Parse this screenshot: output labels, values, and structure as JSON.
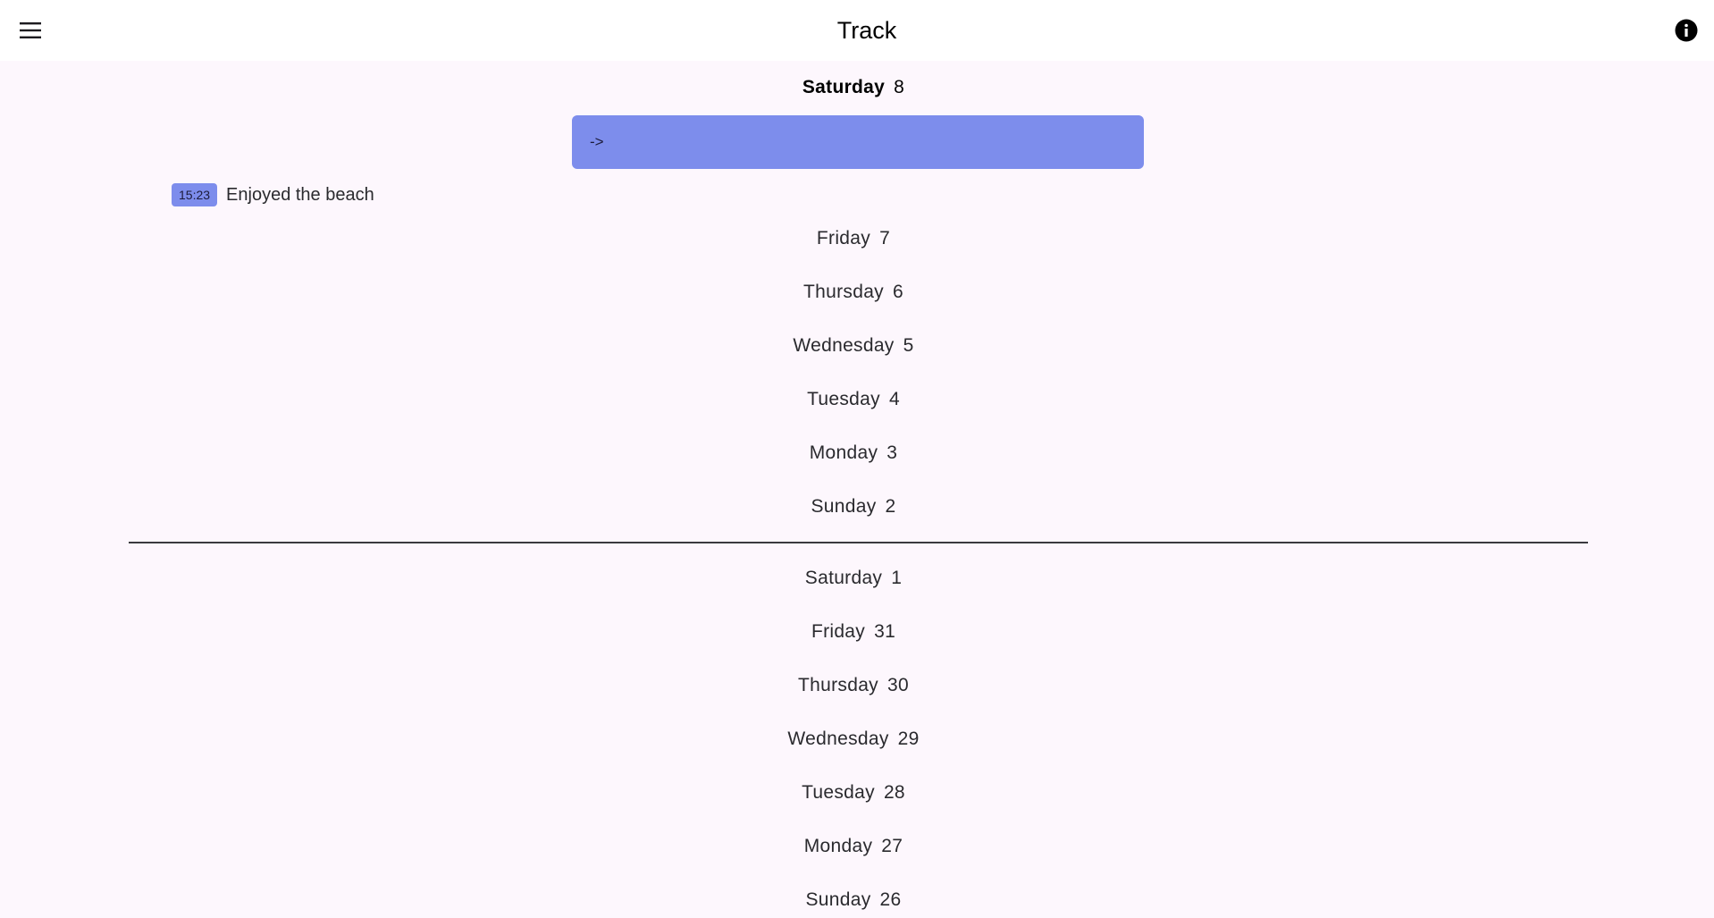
{
  "app_bar": {
    "title": "Track",
    "menu_icon": "hamburger-menu-icon",
    "info_icon": "info-icon"
  },
  "today": {
    "day_name": "Saturday",
    "day_number": "8"
  },
  "entry": {
    "prefix": "->"
  },
  "log": {
    "time": "15:23",
    "text": "Enjoyed the beach"
  },
  "days_this_week": [
    {
      "name": "Friday",
      "num": "7"
    },
    {
      "name": "Thursday",
      "num": "6"
    },
    {
      "name": "Wednesday",
      "num": "5"
    },
    {
      "name": "Tuesday",
      "num": "4"
    },
    {
      "name": "Monday",
      "num": "3"
    },
    {
      "name": "Sunday",
      "num": "2"
    }
  ],
  "days_prev_week": [
    {
      "name": "Saturday",
      "num": "1"
    },
    {
      "name": "Friday",
      "num": "31"
    },
    {
      "name": "Thursday",
      "num": "30"
    },
    {
      "name": "Wednesday",
      "num": "29"
    },
    {
      "name": "Tuesday",
      "num": "28"
    },
    {
      "name": "Monday",
      "num": "27"
    },
    {
      "name": "Sunday",
      "num": "26"
    }
  ],
  "colors": {
    "accent": "#7d8dec",
    "background": "#fdf7fd",
    "app_bar": "#ffffff"
  }
}
